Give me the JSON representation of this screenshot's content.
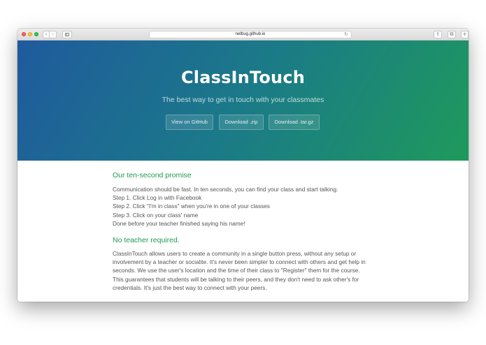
{
  "browser": {
    "url": "netbug.github.io",
    "back_glyph": "‹",
    "forward_glyph": "›",
    "reload_glyph": "↻",
    "share_glyph": "⇪",
    "tabs_glyph": "⧉",
    "newtab_glyph": "+",
    "icons": [
      "close-light",
      "minimize-light",
      "zoom-light",
      "back-icon",
      "forward-icon",
      "sidebar-icon",
      "reload-icon",
      "share-icon",
      "tabs-icon",
      "new-tab-icon"
    ]
  },
  "hero": {
    "title": "ClassInTouch",
    "tagline": "The best way to get in touch with your classmates",
    "buttons": {
      "github": "View on GitHub",
      "zip": "Download .zip",
      "targz": "Download .tar.gz"
    },
    "gradient_colors": [
      "#1f5a9e",
      "#1e9a5c"
    ]
  },
  "promise": {
    "heading": "Our ten-second promise",
    "lines": [
      "Communication should be fast. In ten seconds, you can find your class and start talking.",
      "Step 1. Click Log in with Facebook",
      "Step 2. Click \"I'm in class\" when you're in one of your classes",
      "Step 3. Click on your class' name",
      "Done before your teacher finished saying his name!"
    ]
  },
  "teacher": {
    "heading": "No teacher required.",
    "lines": [
      "ClassInTouch allows users to create a community in a single button press, without any setup or",
      "involvement by a teacher or socialite. It's never been simpler to connect with others and get help in",
      "seconds. We use the user's location and the time of their class to \"Register\" them for the course.",
      "This guarantees that students will be talking to their peers, and they don't need to ask other's for",
      "credentials. It's just the best way to connect with your peers."
    ]
  },
  "colors": {
    "heading_green": "#1e9a4e",
    "body_text": "#555555"
  }
}
